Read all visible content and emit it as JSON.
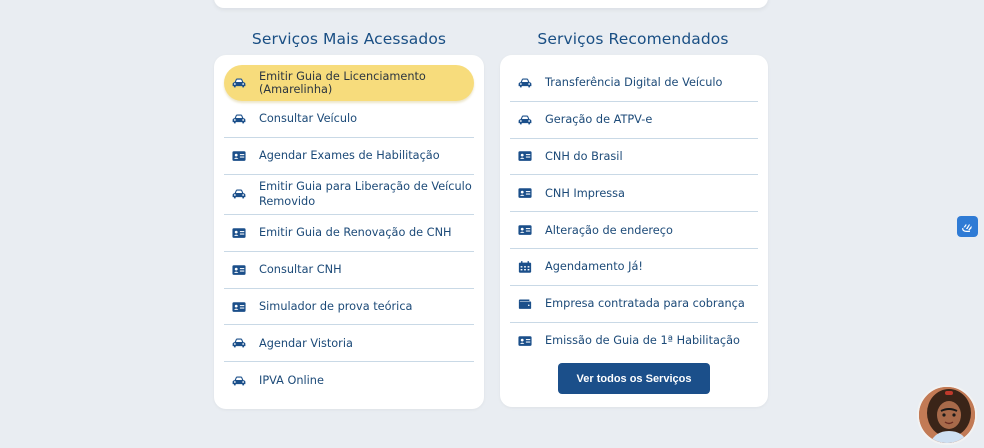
{
  "most_accessed": {
    "title": "Serviços Mais Acessados",
    "items": [
      {
        "label": "Emitir Guia de Licenciamento (Amarelinha)",
        "icon": "car-icon"
      },
      {
        "label": "Consultar Veículo",
        "icon": "car-icon"
      },
      {
        "label": "Agendar Exames de Habilitação",
        "icon": "id-card-icon"
      },
      {
        "label": "Emitir Guia para Liberação de Veículo Removido",
        "icon": "car-icon"
      },
      {
        "label": "Emitir Guia de Renovação de CNH",
        "icon": "id-card-icon"
      },
      {
        "label": "Consultar CNH",
        "icon": "id-card-icon"
      },
      {
        "label": "Simulador de prova teórica",
        "icon": "id-card-icon"
      },
      {
        "label": "Agendar Vistoria",
        "icon": "car-icon"
      },
      {
        "label": "IPVA Online",
        "icon": "car-icon"
      }
    ]
  },
  "recommended": {
    "title": "Serviços Recomendados",
    "items": [
      {
        "label": "Transferência Digital de Veículo",
        "icon": "car-icon"
      },
      {
        "label": "Geração de ATPV-e",
        "icon": "car-icon"
      },
      {
        "label": "CNH do Brasil",
        "icon": "id-card-icon"
      },
      {
        "label": "CNH Impressa",
        "icon": "id-card-icon"
      },
      {
        "label": "Alteração de endereço",
        "icon": "id-card-icon"
      },
      {
        "label": "Agendamento Já!",
        "icon": "calendar-icon"
      },
      {
        "label": "Empresa contratada para cobrança",
        "icon": "wallet-icon"
      },
      {
        "label": "Emissão de Guia de 1ª Habilitação",
        "icon": "id-card-icon"
      }
    ],
    "button_label": "Ver todos os Serviços"
  },
  "colors": {
    "accent": "#1b4f8a",
    "highlight": "#f7dc7c",
    "background": "#e9edf2"
  }
}
